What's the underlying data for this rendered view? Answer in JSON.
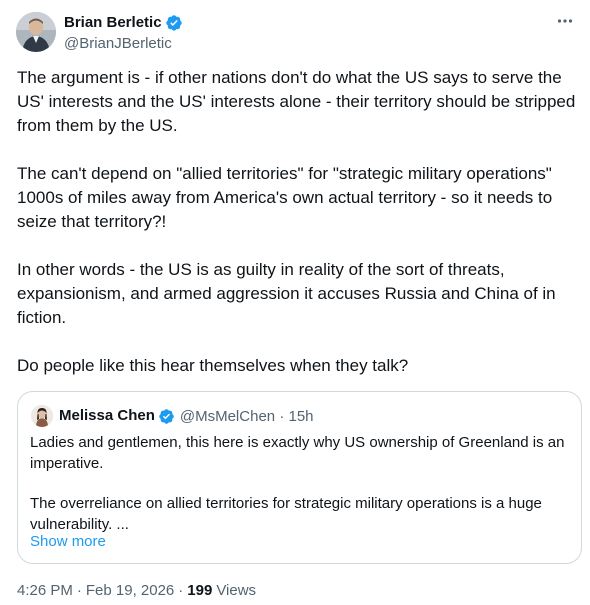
{
  "author": {
    "name": "Brian Berletic",
    "handle": "@BrianJBerletic"
  },
  "tweet": {
    "paragraphs": [
      "The argument is - if other nations don't do what the US says to serve the US' interests and the US' interests alone - their territory should be stripped from them by the US.",
      "The can't depend on \"allied territories\" for \"strategic military operations\" 1000s of miles away from America's own actual territory - so it needs to seize that territory?!",
      "In other words - the US is as guilty in reality of the sort of threats, expansionism, and armed aggression it accuses Russia and China of in fiction.",
      "Do people like this hear themselves when they talk?"
    ]
  },
  "quote": {
    "name": "Melissa Chen",
    "handle": "@MsMelChen",
    "separator": "·",
    "age": "15h",
    "paragraphs": [
      "Ladies and gentlemen, this here is exactly why US ownership of Greenland is an imperative.",
      "The overreliance on allied territories for strategic military operations is a huge vulnerability. ..."
    ],
    "show_more": "Show more"
  },
  "footer": {
    "time": "4:26 PM",
    "separator": "·",
    "date": "Feb 19, 2026",
    "views_count": "199",
    "views_label": "Views"
  },
  "icons": {
    "more": "more-horizontal-icon",
    "verified": "verified-badge-icon"
  },
  "colors": {
    "accent": "#1d9bf0",
    "text": "#0f1419",
    "secondary": "#536471",
    "border": "#cfd9de"
  }
}
